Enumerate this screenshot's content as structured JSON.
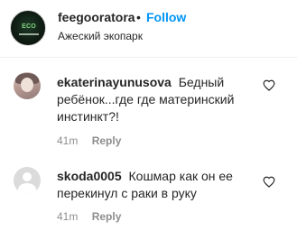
{
  "post_header": {
    "username": "feegooratora",
    "separator": "•",
    "follow_label": "Follow",
    "location": "Ажеский экопарк",
    "avatar_logo_text": "ECO"
  },
  "comments": [
    {
      "username": "ekaterinayunusova",
      "text": "Бедный ребёнок...где где материнский инстинкт?!",
      "time": "41m",
      "reply_label": "Reply",
      "like_icon": "heart-outline-icon"
    },
    {
      "username": "skoda0005",
      "text": "Кошмар как он ее перекинул с раки в руку",
      "time": "41m",
      "reply_label": "Reply",
      "like_icon": "heart-outline-icon"
    }
  ],
  "colors": {
    "text": "#262626",
    "secondary": "#8e8e8e",
    "link_blue": "#0095f6",
    "divider": "#efefef"
  }
}
